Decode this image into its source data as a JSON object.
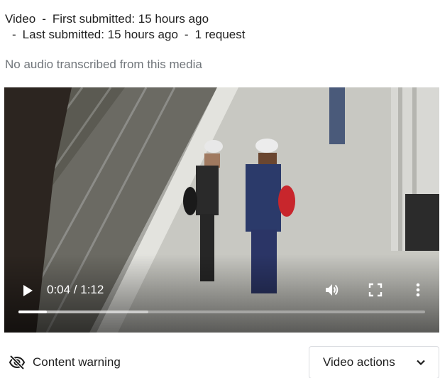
{
  "header": {
    "media_type": "Video",
    "first_submitted": "First submitted: 15 hours ago",
    "last_submitted": "Last submitted: 15 hours ago",
    "request_count": "1 request",
    "separator": "-"
  },
  "transcript_status": "No audio transcribed from this media",
  "player": {
    "time_display": "0:04 / 1:12",
    "played_fraction": 0.07,
    "buffered_fraction": 0.32,
    "icons": {
      "play": "play-icon",
      "volume": "volume-icon",
      "fullscreen": "fullscreen-icon",
      "more": "more-vert-icon"
    }
  },
  "footer": {
    "content_warning_label": "Content warning",
    "content_warning_icon": "visibility-off-icon",
    "video_actions_label": "Video actions",
    "video_actions_icon": "chevron-down-icon"
  }
}
